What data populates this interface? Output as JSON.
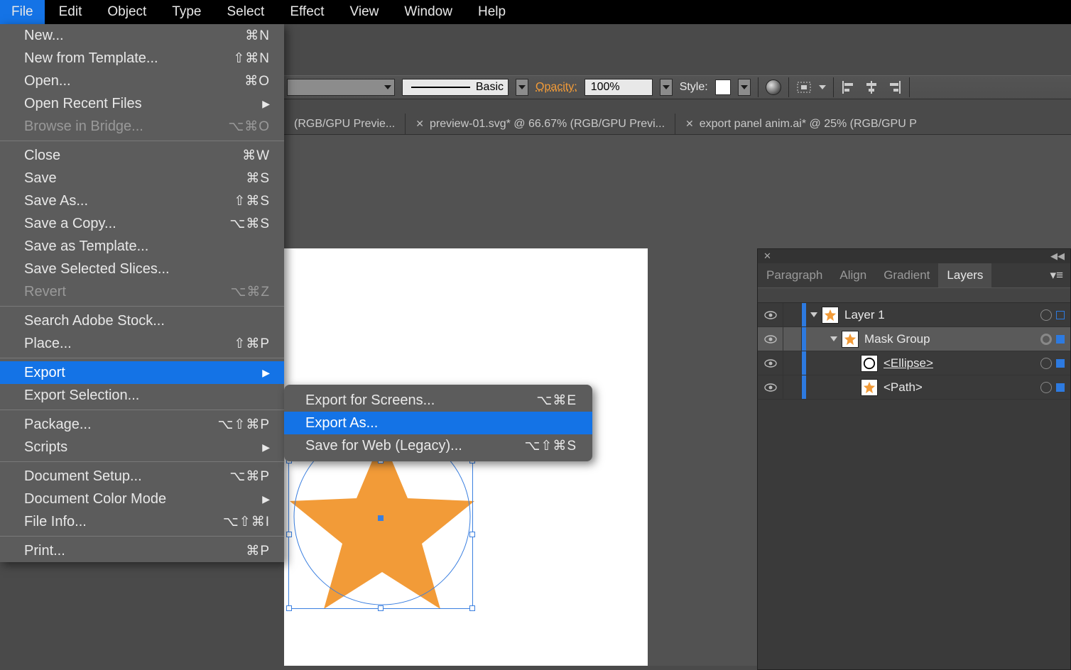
{
  "menubar": [
    "File",
    "Edit",
    "Object",
    "Type",
    "Select",
    "Effect",
    "View",
    "Window",
    "Help"
  ],
  "file_menu": {
    "g1": [
      {
        "label": "New...",
        "shortcut": "⌘N"
      },
      {
        "label": "New from Template...",
        "shortcut": "⇧⌘N"
      },
      {
        "label": "Open...",
        "shortcut": "⌘O"
      },
      {
        "label": "Open Recent Files",
        "arrow": true
      },
      {
        "label": "Browse in Bridge...",
        "shortcut": "⌥⌘O",
        "disabled": true
      }
    ],
    "g2": [
      {
        "label": "Close",
        "shortcut": "⌘W"
      },
      {
        "label": "Save",
        "shortcut": "⌘S"
      },
      {
        "label": "Save As...",
        "shortcut": "⇧⌘S"
      },
      {
        "label": "Save a Copy...",
        "shortcut": "⌥⌘S"
      },
      {
        "label": "Save as Template..."
      },
      {
        "label": "Save Selected Slices..."
      },
      {
        "label": "Revert",
        "shortcut": "⌥⌘Z",
        "disabled": true
      }
    ],
    "g3": [
      {
        "label": "Search Adobe Stock..."
      },
      {
        "label": "Place...",
        "shortcut": "⇧⌘P"
      }
    ],
    "g4": [
      {
        "label": "Export",
        "arrow": true,
        "hl": true
      },
      {
        "label": "Export Selection..."
      }
    ],
    "g5": [
      {
        "label": "Package...",
        "shortcut": "⌥⇧⌘P"
      },
      {
        "label": "Scripts",
        "arrow": true
      }
    ],
    "g6": [
      {
        "label": "Document Setup...",
        "shortcut": "⌥⌘P"
      },
      {
        "label": "Document Color Mode",
        "arrow": true
      },
      {
        "label": "File Info...",
        "shortcut": "⌥⇧⌘I"
      }
    ],
    "g7": [
      {
        "label": "Print...",
        "shortcut": "⌘P"
      }
    ]
  },
  "export_submenu": [
    {
      "label": "Export for Screens...",
      "shortcut": "⌥⌘E"
    },
    {
      "label": "Export As...",
      "hl": true
    },
    {
      "label": "Save for Web (Legacy)...",
      "shortcut": "⌥⇧⌘S"
    }
  ],
  "optbar": {
    "stroke_preset": "Basic",
    "opacity_label": "Opacity:",
    "opacity_value": "100%",
    "style_label": "Style:"
  },
  "tabs": [
    "(RGB/GPU Previe...",
    "preview-01.svg* @ 66.67% (RGB/GPU Previ...",
    "export panel anim.ai* @ 25% (RGB/GPU P"
  ],
  "panel": {
    "tabs": [
      "Paragraph",
      "Align",
      "Gradient",
      "Layers"
    ],
    "layers": [
      {
        "name": "Layer 1",
        "indent": 0,
        "disclose": true,
        "thumb": "star",
        "sel": false,
        "target": false
      },
      {
        "name": "Mask Group",
        "indent": 1,
        "disclose": true,
        "thumb": "star",
        "sel": true,
        "target": true,
        "row_sel": true
      },
      {
        "name": "<Ellipse>",
        "indent": 2,
        "thumb": "ellipse",
        "underline": true,
        "sel": true
      },
      {
        "name": "<Path>",
        "indent": 2,
        "thumb": "star",
        "sel": true
      }
    ]
  }
}
